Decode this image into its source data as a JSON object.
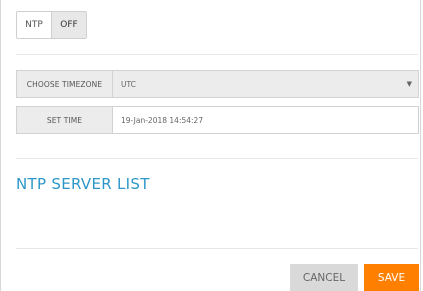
{
  "ntp": {
    "label": "NTP",
    "state": "OFF"
  },
  "timezone": {
    "label": "CHOOSE TIMEZONE",
    "selected": "UTC",
    "caret_icon": "caret-down-icon"
  },
  "set_time": {
    "label": "SET TIME",
    "value": "19-Jan-2018 14:54:27"
  },
  "ntp_server_list": {
    "title": "NTP SERVER LIST"
  },
  "actions": {
    "cancel_label": "CANCEL",
    "save_label": "SAVE"
  },
  "colors": {
    "accent": "#2d97c9",
    "save": "#ff8000",
    "cancel": "#d9d9d9"
  }
}
